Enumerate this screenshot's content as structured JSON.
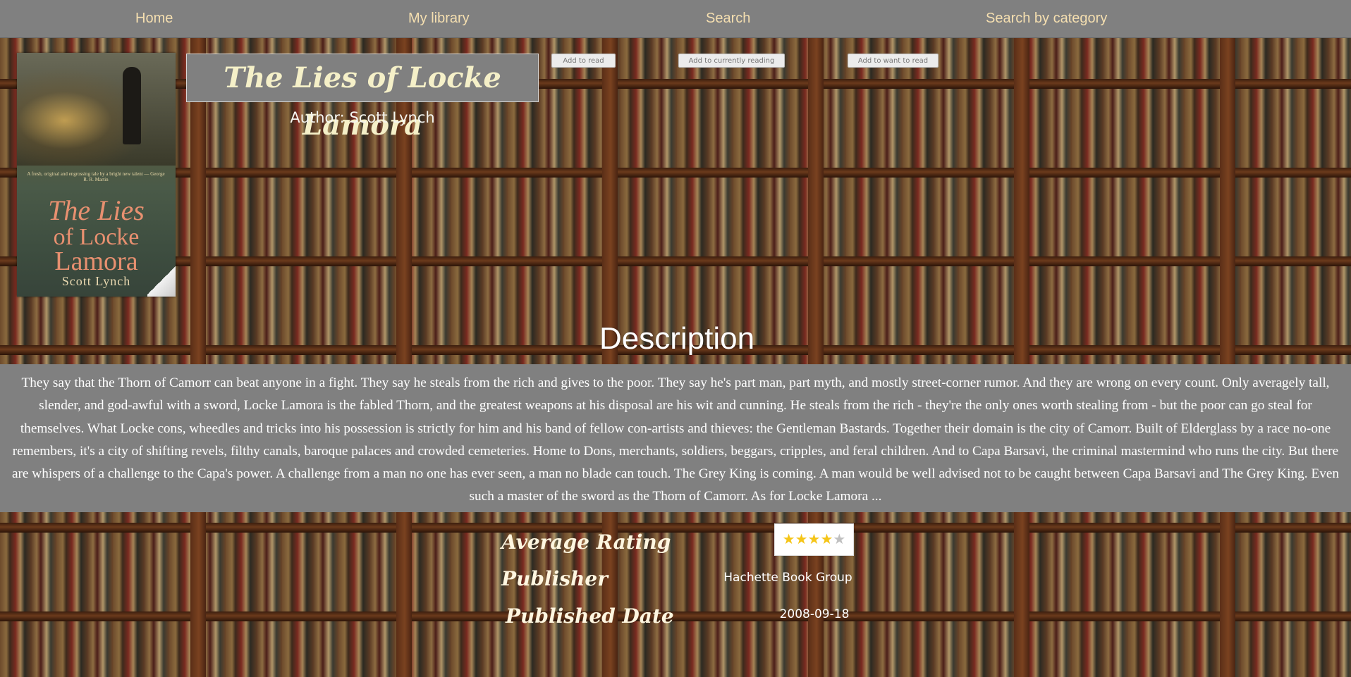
{
  "nav": {
    "home": "Home",
    "library": "My library",
    "search": "Search",
    "category": "Search by category"
  },
  "book": {
    "title": "The Lies of Locke Lamora",
    "author_label": "Author:",
    "author": "Scott Lynch",
    "cover": {
      "blurb": "A fresh, original and engrossing tale by a bright new talent — George R. R. Martin",
      "line1": "The Lies",
      "line2": "of Locke",
      "line3": "Lamora",
      "author": "Scott Lynch"
    }
  },
  "actions": {
    "read": "Add to read",
    "current": "Add to currently reading",
    "want": "Add to want to read"
  },
  "description": {
    "heading": "Description",
    "text": "They say that the Thorn of Camorr can beat anyone in a fight. They say he steals from the rich and gives to the poor. They say he's part man, part myth, and mostly street-corner rumor. And they are wrong on every count. Only averagely tall, slender, and god-awful with a sword, Locke Lamora is the fabled Thorn, and the greatest weapons at his disposal are his wit and cunning. He steals from the rich - they're the only ones worth stealing from - but the poor can go steal for themselves. What Locke cons, wheedles and tricks into his possession is strictly for him and his band of fellow con-artists and thieves: the Gentleman Bastards. Together their domain is the city of Camorr. Built of Elderglass by a race no-one remembers, it's a city of shifting revels, filthy canals, baroque palaces and crowded cemeteries. Home to Dons, merchants, soldiers, beggars, cripples, and feral children. And to Capa Barsavi, the criminal mastermind who runs the city. But there are whispers of a challenge to the Capa's power. A challenge from a man no one has ever seen, a man no blade can touch. The Grey King is coming. A man would be well advised not to be caught between Capa Barsavi and The Grey King. Even such a master of the sword as the Thorn of Camorr. As for Locke Lamora ..."
  },
  "details": {
    "rating_label": "Average Rating",
    "rating_stars": 4,
    "rating_max": 5,
    "publisher_label": "Publisher",
    "publisher": "Hachette Book Group",
    "date_label": "Published Date",
    "date": "2008-09-18"
  },
  "colors": {
    "nav_bg": "#808080",
    "nav_text": "#f5dfb0",
    "star_on": "#f5c518",
    "star_off": "#c0c0c0"
  }
}
